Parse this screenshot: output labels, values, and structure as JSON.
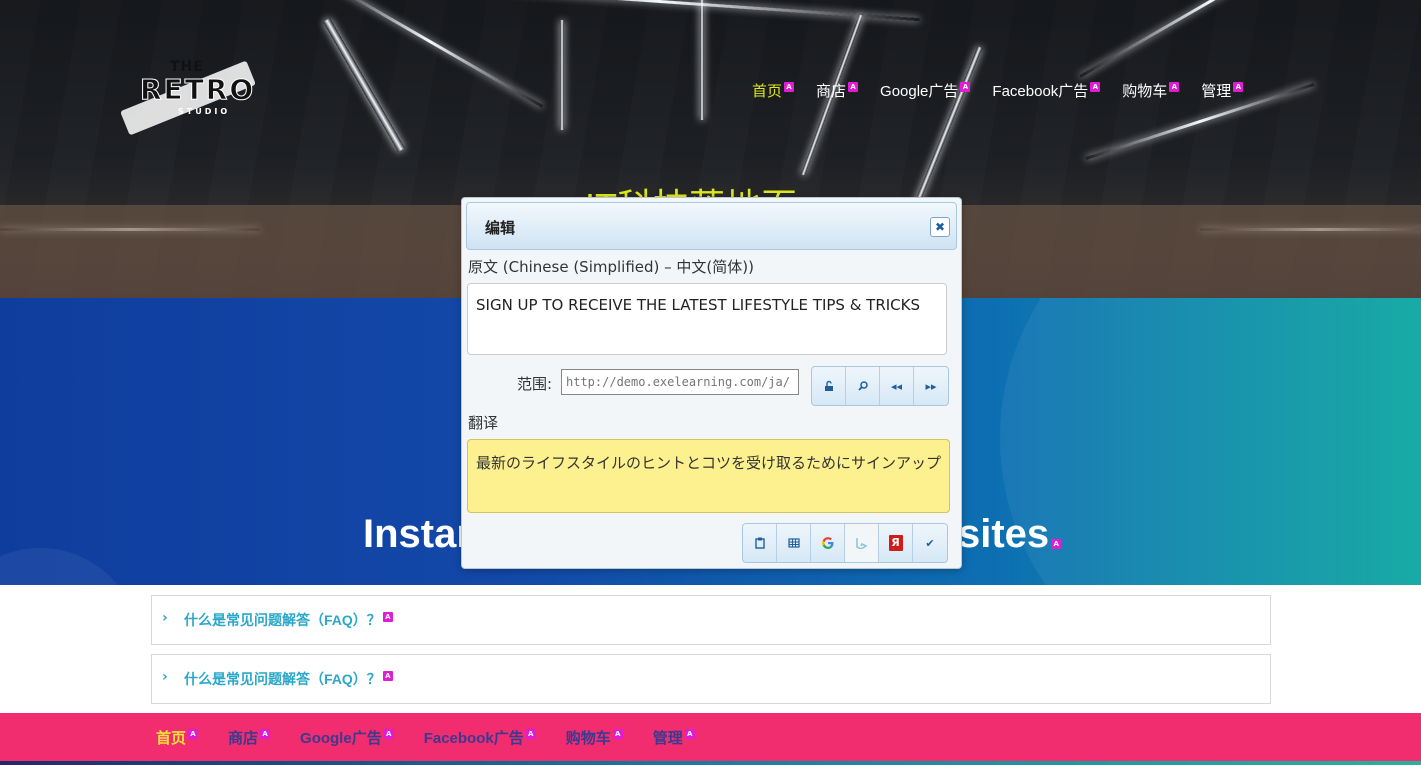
{
  "logo": {
    "line1": "THE",
    "line2": "RETRO",
    "line3": "STUDIO"
  },
  "badge": "A",
  "nav": [
    {
      "label": "首页",
      "active": true
    },
    {
      "label": "商店",
      "active": false
    },
    {
      "label": "Google广告",
      "active": false
    },
    {
      "label": "Facebook广告",
      "active": false
    },
    {
      "label": "购物车",
      "active": false
    },
    {
      "label": "管理",
      "active": false
    }
  ],
  "hero": {
    "title": "IT科技落地页"
  },
  "band": {
    "heading_left": "Instar",
    "heading_right": "sites"
  },
  "faq": [
    {
      "question": "什么是常见问题解答（FAQ）？"
    },
    {
      "question": "什么是常见问题解答（FAQ）？"
    }
  ],
  "dialog": {
    "title": "编辑",
    "source_label": "原文 (Chinese (Simplified) – 中文(简体))",
    "source_text": "SIGN UP TO RECEIVE THE LATEST LIFESTYLE TIPS & TRICKS",
    "scope_label": "范围:",
    "scope_placeholder": "http://demo.exelearning.com/ja/",
    "translation_label": "翻译",
    "translation_text": "最新のライフスタイルのヒントとコツを受け取るためにサインアップ",
    "scope_buttons": [
      "unlock-icon",
      "search-icon",
      "prev-icon",
      "next-icon"
    ],
    "action_buttons": [
      "clipboard-icon",
      "table-icon",
      "google-icon",
      "bing-icon",
      "yandex-icon",
      "check-icon"
    ]
  },
  "colors": {
    "accent_yellow": "#dfe91a",
    "footer_pink": "#f22d6f",
    "badge_magenta": "#e01cd5",
    "faq_text": "#2aa7c9"
  }
}
